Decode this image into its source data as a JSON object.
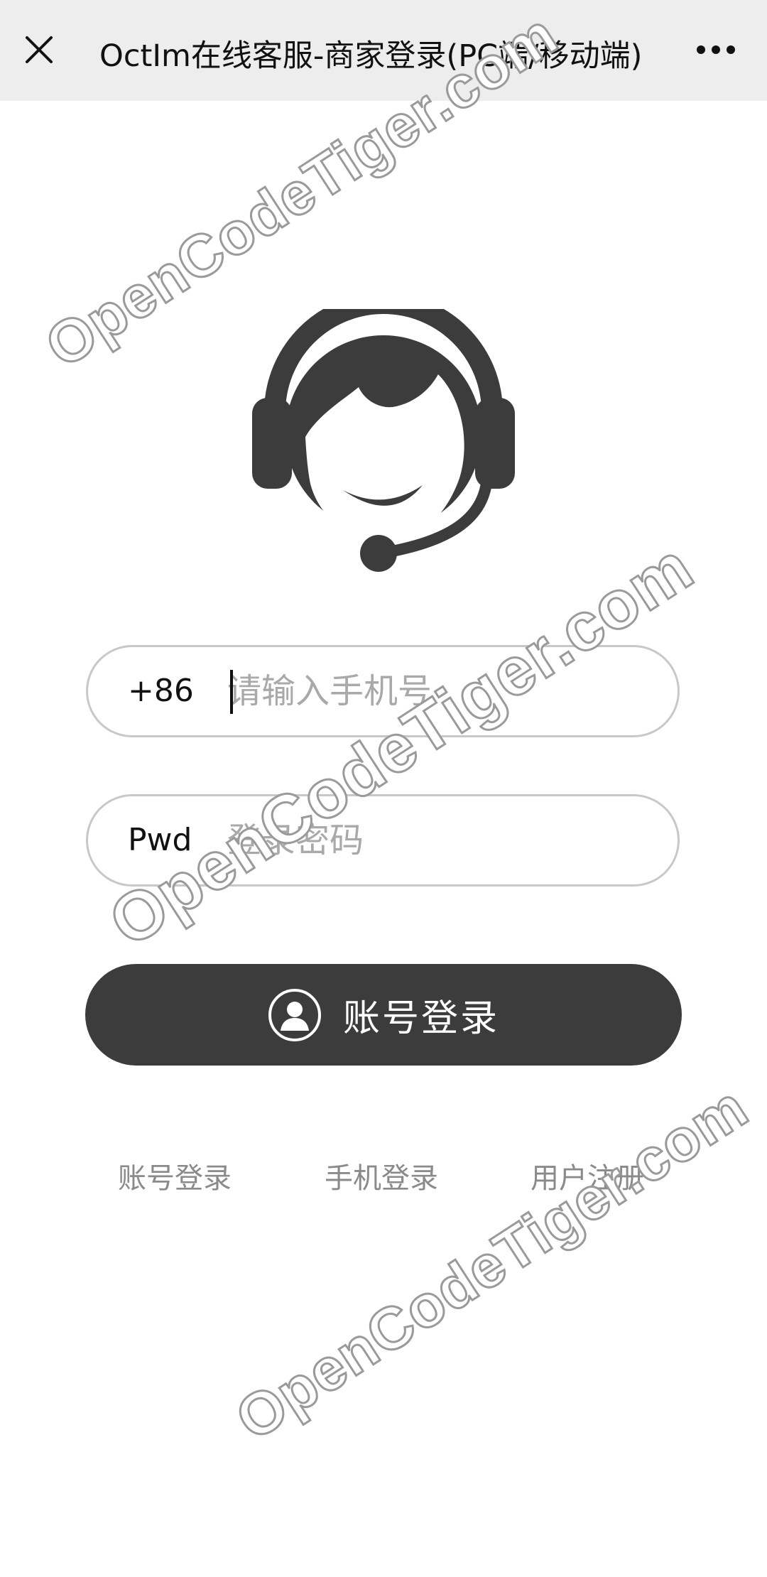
{
  "header": {
    "title": "OctIm在线客服-商家登录(PC端/移动端)",
    "close_icon": "close-icon",
    "more_icon": "more-dots-icon"
  },
  "avatar": {
    "icon": "customer-service-headset-icon"
  },
  "form": {
    "phone": {
      "prefix": "+86",
      "placeholder": "请输入手机号",
      "value": ""
    },
    "password": {
      "prefix": "Pwd",
      "placeholder": "登录密码",
      "value": ""
    },
    "submit": {
      "label": "账号登录",
      "icon": "user-circle-icon"
    }
  },
  "links": {
    "account_login": "账号登录",
    "phone_login": "手机登录",
    "register": "用户注册"
  },
  "watermark": {
    "text": "OpenCodeTiger.com"
  },
  "colors": {
    "header_bg": "#ededed",
    "button_bg": "#3c3c3c",
    "field_border": "#c8c8c8",
    "link_text": "#8a8a8a",
    "placeholder": "#a9a9a9"
  }
}
